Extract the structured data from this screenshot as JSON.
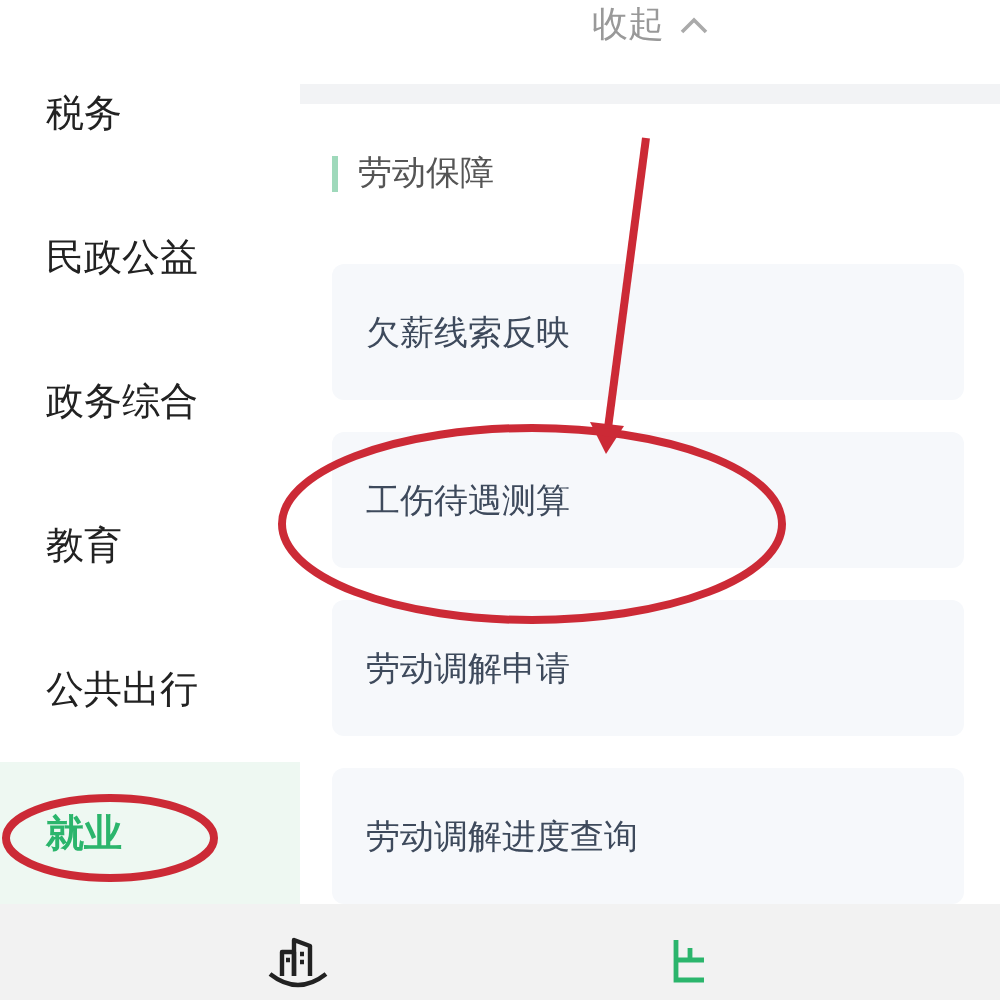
{
  "sidebar": {
    "items": [
      {
        "label": "税务",
        "selected": false
      },
      {
        "label": "民政公益",
        "selected": false
      },
      {
        "label": "政务综合",
        "selected": false
      },
      {
        "label": "教育",
        "selected": false
      },
      {
        "label": "公共出行",
        "selected": false
      },
      {
        "label": "就业",
        "selected": true
      }
    ]
  },
  "collapse": {
    "label": "收起"
  },
  "section": {
    "title": "劳动保障",
    "cards": [
      {
        "label": "欠薪线索反映"
      },
      {
        "label": "工伤待遇测算"
      },
      {
        "label": "劳动调解申请"
      },
      {
        "label": "劳动调解进度查询"
      }
    ]
  }
}
